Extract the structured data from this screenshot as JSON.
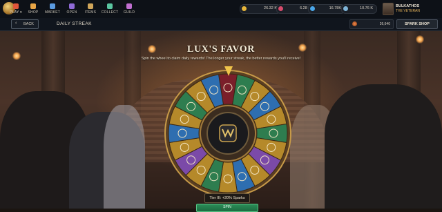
{
  "nav": {
    "items": [
      {
        "label": "PLAY ▾",
        "color": "#e0553a"
      },
      {
        "label": "SHOP",
        "color": "#e8a646"
      },
      {
        "label": "MARKET",
        "color": "#5a9be0"
      },
      {
        "label": "OPEN",
        "color": "#8f6ad6"
      },
      {
        "label": "ITEMS",
        "color": "#d0a65a"
      },
      {
        "label": "COLLECT",
        "color": "#5ac5a0"
      },
      {
        "label": "GUILD",
        "color": "#c06fd0"
      }
    ],
    "currencies": [
      {
        "value": "26.32 K",
        "icon": "gold-coin-icon",
        "color": "#e6b53a"
      },
      {
        "value": "6.28 K",
        "icon": "gem-icon",
        "color": "#d64b6b"
      },
      {
        "value": "16.78K",
        "icon": "feather-icon",
        "color": "#4aa6e8"
      },
      {
        "value": "10.76 K",
        "icon": "shard-icon",
        "color": "#7fb5d8"
      }
    ],
    "user": {
      "name": "BULKATHOS",
      "title": "THE VETERAN"
    }
  },
  "subbar": {
    "back_label": "BACK",
    "page_title": "DAILY STREAK",
    "sparks_value": "26,640",
    "spark_shop_label": "SPARK SHOP"
  },
  "main": {
    "title": "LUX'S FAVOR",
    "subtitle": "Spin the wheel to claim daily rewards! The longer your streak, the better rewards you'll receive!",
    "tier_label": "Tier III: +20% Sparks",
    "spin_label": "SPIN"
  },
  "wheel": {
    "segment_colors": [
      "#7a1f2a",
      "#2e7d4f",
      "#b5892a",
      "#2e6eb0",
      "#b5892a",
      "#2e7d4f",
      "#b5892a",
      "#7b4aa8",
      "#b5892a",
      "#2e6eb0",
      "#b5892a",
      "#2e7d4f",
      "#b5892a",
      "#7b4aa8",
      "#b5892a",
      "#2e6eb0",
      "#b5892a",
      "#2e7d4f",
      "#b5892a",
      "#2e6eb0"
    ],
    "accent": "#f0c44a"
  }
}
